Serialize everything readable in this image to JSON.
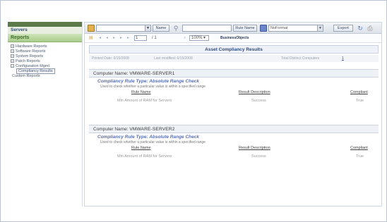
{
  "sidebar": {
    "header": "",
    "servers_label": "Servers",
    "reports_label": "Reports",
    "items": [
      {
        "label": "Hardware Reports",
        "expander": "+"
      },
      {
        "label": "Software Reports",
        "expander": "+"
      },
      {
        "label": "System Reports",
        "expander": "+"
      },
      {
        "label": "Patch Reports",
        "expander": "+"
      },
      {
        "label": "Configuration Mgmt",
        "expander": "-"
      }
    ],
    "selected_subitem": "Compliancy Results",
    "custom_reports": "Custom Reports"
  },
  "toolbar": {
    "name_button": "Name",
    "rule_name_button": "Rule Name",
    "format_value": "NoFormat",
    "export_button": "Export"
  },
  "navbar": {
    "page_input": "1",
    "page_total": "/ 1",
    "zoom_value": "100%",
    "business_objects": "BusinessObjects"
  },
  "report": {
    "title": "Asset Compliancy Results",
    "printed_date": "Printed Date: 6/15/2008",
    "last_modified": "Last modified: 6/15/2008",
    "total_label": "Total Distinct Computers",
    "total_value": "1"
  },
  "sections": [
    {
      "computer_name_label": "Computer Name:",
      "computer_name": "VMWARE-SERVER1",
      "rule_type": "Compliancy Rule Type: Absolute Range Check",
      "rule_desc": "Used to check whether a particular value is within a specified range",
      "col_rule_name": "Rule Name",
      "col_result": "Result Description",
      "col_compliant": "Compliant",
      "row_rule": "Min Amount of RAM for Servers",
      "row_result": "Success",
      "row_compliant": "True"
    },
    {
      "computer_name_label": "Computer Name:",
      "computer_name": "VMWARE-SERVER2",
      "rule_type": "Compliancy Rule Type: Absolute Range Check",
      "rule_desc": "Used to check whether a particular value is within a specified range",
      "col_rule_name": "Rule Name",
      "col_result": "Result Description",
      "col_compliant": "Compliant",
      "row_rule": "Min Amount of RAM for Servers",
      "row_result": "Success",
      "row_compliant": "True"
    }
  ],
  "colors": {
    "accent": "#5a6fb3",
    "sidebar_header": "#a9cd8c",
    "title_text": "#2d4a7e"
  }
}
